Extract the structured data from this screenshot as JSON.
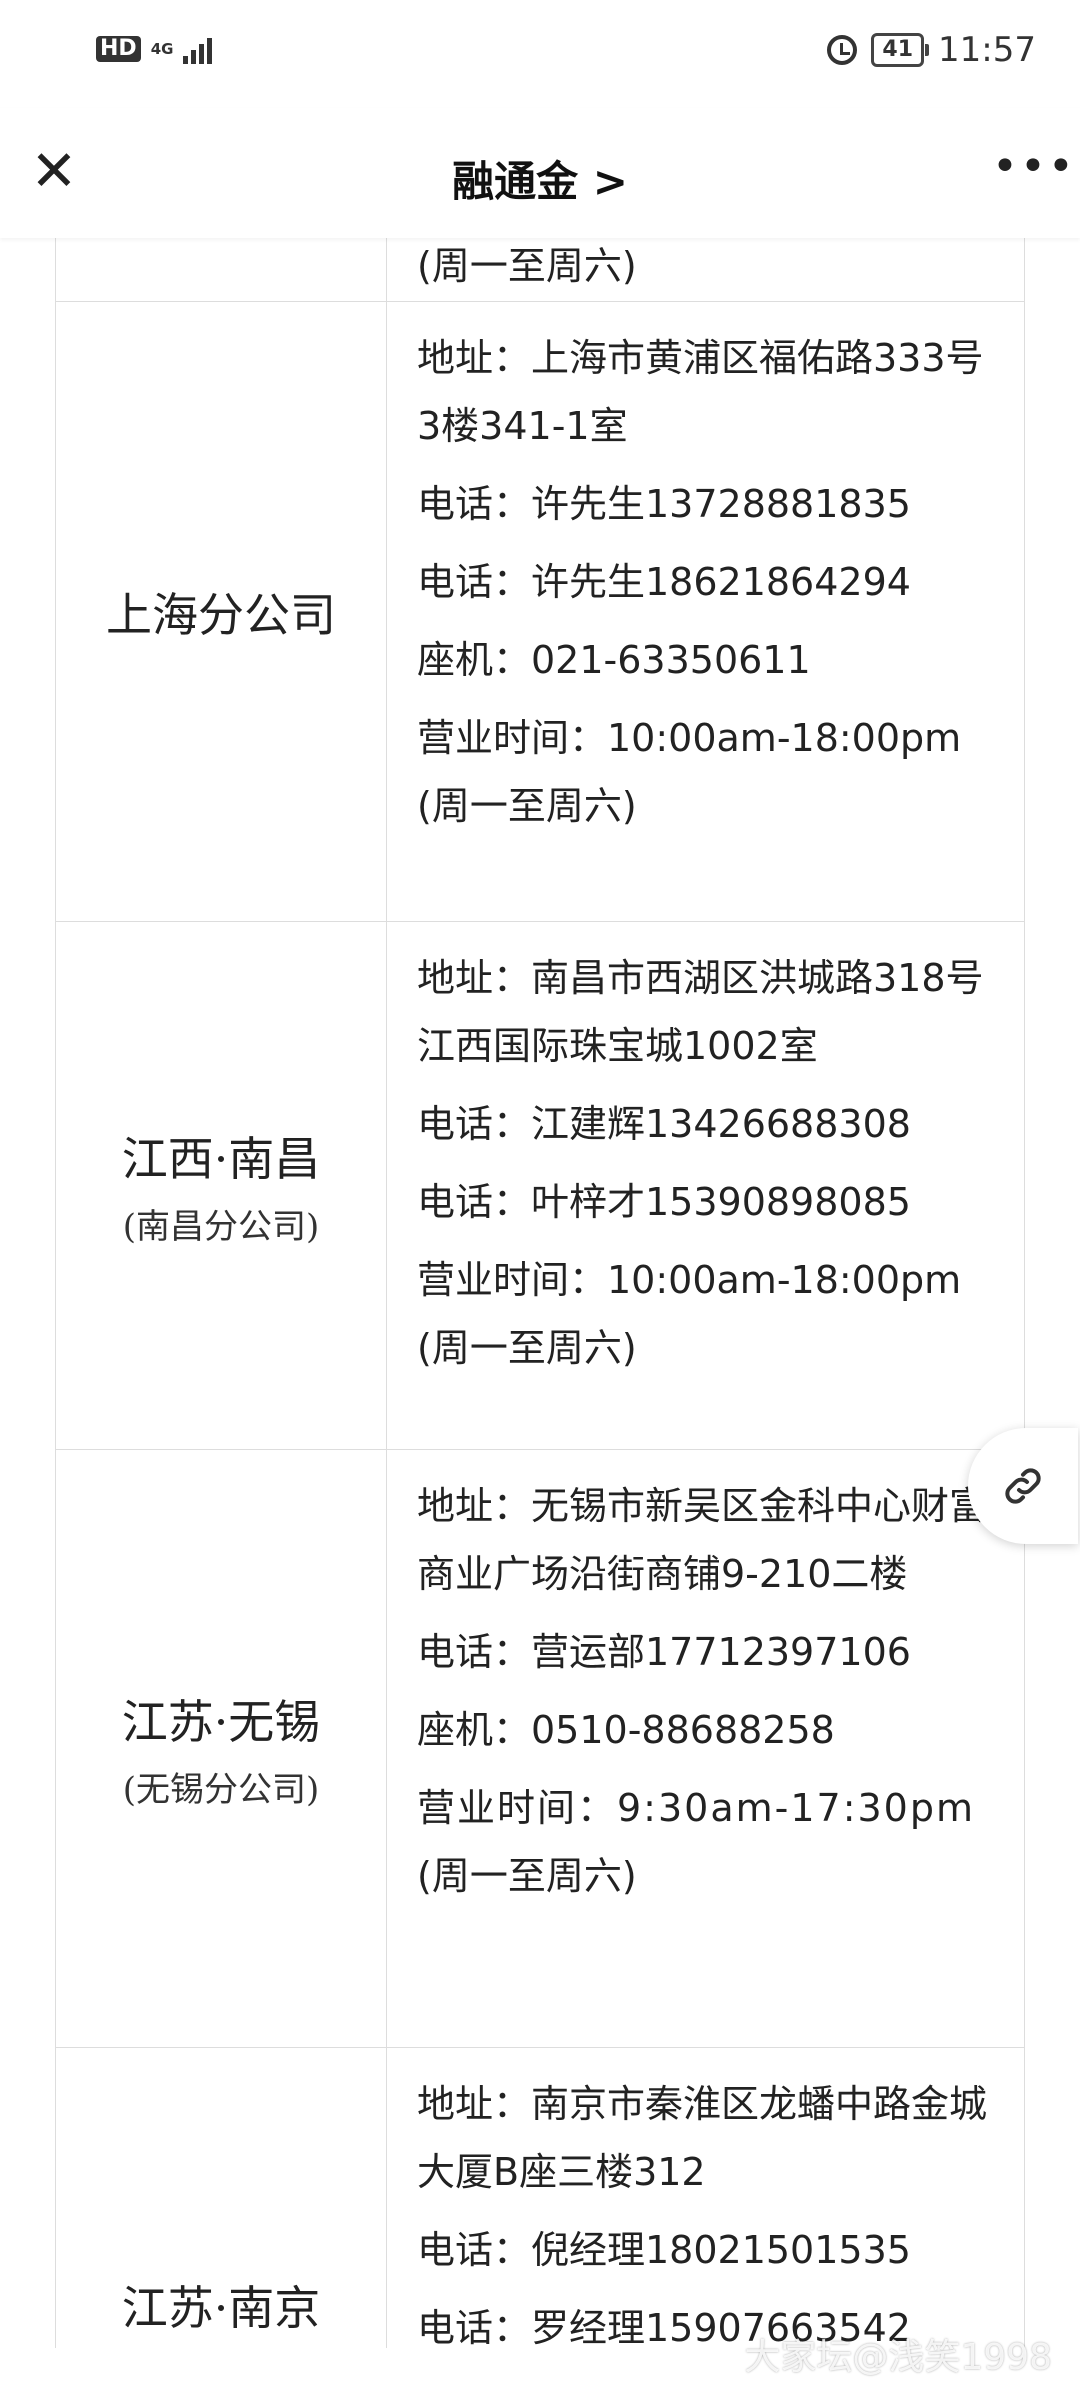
{
  "status_bar": {
    "hd": "HD",
    "network": "4G",
    "battery": "41",
    "time": "11:57"
  },
  "nav": {
    "title": "融通金 >"
  },
  "rows": [
    {
      "lines": [
        "(周一至周六)"
      ]
    },
    {
      "name": "上海分公司",
      "lines": [
        "地址：上海市黄浦区福佑路333号3楼341-1室",
        "电话：许先生13728881835",
        "电话：许先生18621864294",
        "座机：021-63350611",
        "营业时间：10:00am-18:00pm",
        "(周一至周六)"
      ]
    },
    {
      "name": "江西·南昌",
      "sub": "(南昌分公司)",
      "lines": [
        "地址：南昌市西湖区洪城路318号江西国际珠宝城1002室",
        "电话：江建辉13426688308",
        "电话：叶梓才15390898085",
        "营业时间：10:00am-18:00pm",
        "(周一至周六)"
      ]
    },
    {
      "name": "江苏·无锡",
      "sub": "(无锡分公司)",
      "lines": [
        "地址：无锡市新吴区金科中心财富商业广场沿街商铺9-210二楼",
        "电话：营运部17712397106",
        "座机：0510-88688258",
        "营业时间：9:30am-17:30pm",
        "(周一至周六)"
      ]
    },
    {
      "name": "江苏·南京",
      "lines": [
        "地址：南京市秦淮区龙蟠中路金城大厦B座三楼312",
        "电话：倪经理18021501535",
        "电话：罗经理15907663542"
      ]
    }
  ],
  "watermark": "大家坛@浅笑1998"
}
